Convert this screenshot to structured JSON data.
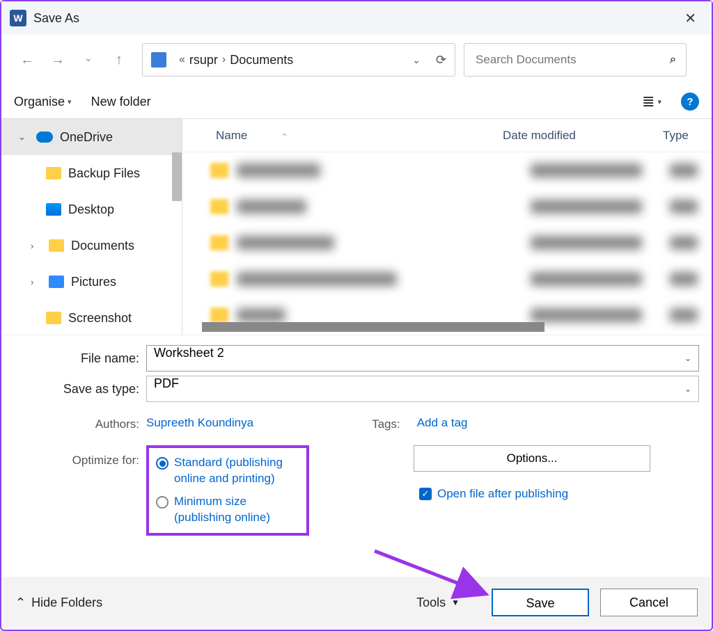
{
  "title": "Save As",
  "breadcrumb": {
    "parent": "rsupr",
    "current": "Documents"
  },
  "search": {
    "placeholder": "Search Documents"
  },
  "toolbar": {
    "organise": "Organise",
    "new_folder": "New folder"
  },
  "tree": {
    "items": [
      {
        "label": "OneDrive"
      },
      {
        "label": "Backup Files"
      },
      {
        "label": "Desktop"
      },
      {
        "label": "Documents"
      },
      {
        "label": "Pictures"
      },
      {
        "label": "Screenshot"
      }
    ]
  },
  "columns": {
    "name": "Name",
    "date": "Date modified",
    "type": "Type"
  },
  "form": {
    "filename_label": "File name:",
    "filename_value": "Worksheet 2",
    "saveastype_label": "Save as type:",
    "saveastype_value": "PDF",
    "authors_label": "Authors:",
    "authors_value": "Supreeth Koundinya",
    "tags_label": "Tags:",
    "tags_value": "Add a tag",
    "optimize_label": "Optimize for:",
    "radio_standard": "Standard (publishing online and printing)",
    "radio_minimum": "Minimum size (publishing online)",
    "options_btn": "Options...",
    "open_after": "Open file after publishing"
  },
  "footer": {
    "hide_folders": "Hide Folders",
    "tools": "Tools",
    "save": "Save",
    "cancel": "Cancel"
  }
}
